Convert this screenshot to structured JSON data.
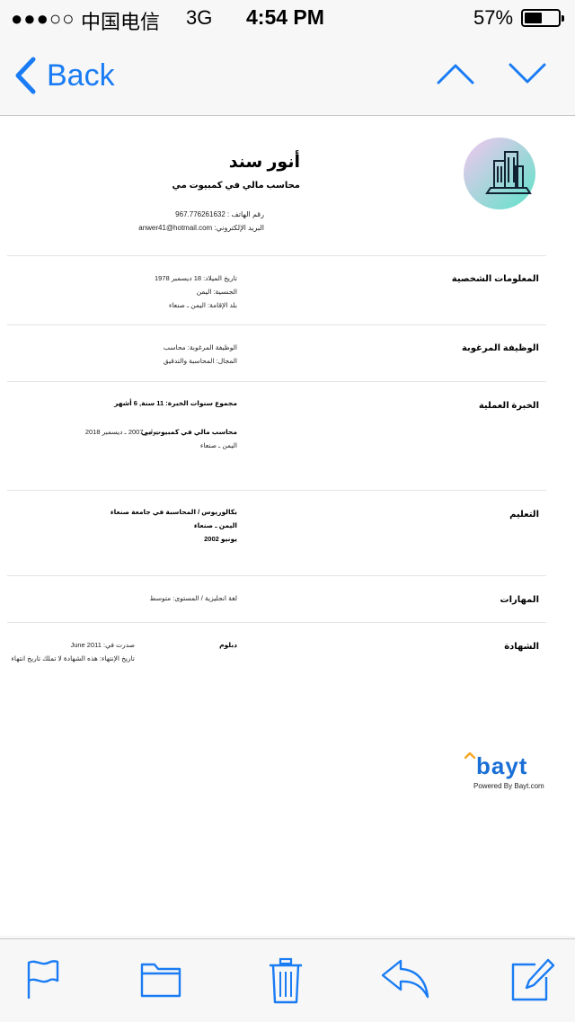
{
  "status_bar": {
    "signal": "●●●○○",
    "carrier": "中国电信",
    "network": "3G",
    "time": "4:54 PM",
    "battery": "57%",
    "battery_level": 0.57
  },
  "nav": {
    "back_label": "Back",
    "accent_color": "#1a7cf4"
  },
  "resume": {
    "name": "أنور سند",
    "subtitle": "محاسب مالي في كمبيوت مي",
    "phone": "رقم الهاتف : 967.776261632",
    "email": "البريد الإلكتروني: anwer41@hotmail.com",
    "sections": {
      "personal": {
        "heading": "المعلومات الشخصية",
        "lines": [
          "تاريخ الميلاد: 18 ديسمبر 1978",
          "الجنسية: اليمن",
          "بلد الإقامة: اليمن ـ صنعاء"
        ]
      },
      "desired_job": {
        "heading": "الوظيفة المرغوبة",
        "lines": [
          "الوظيفة المرغوبة: محاسب",
          "المجال: المحاسبة والتدقيق"
        ]
      },
      "experience": {
        "heading": "الخبرة العملية",
        "total": "مجموع سنوات الخبرة: 11 سنة, 6 أشهر",
        "job_title": "محاسب مالي في كمبيوت مي",
        "job_location": "اليمن ـ صنعاء",
        "job_dates": "يوليو 2007 ـ ديسمبر 2018"
      },
      "education": {
        "heading": "التعليم",
        "degree": "بكالوريوس / المحاسبة في جامعة صنعاء",
        "location": "اليمن ـ صنعاء",
        "date": "يونيو 2002"
      },
      "skills": {
        "heading": "المهارات",
        "line": "لغة انجليزية / المستوى: متوسط"
      },
      "certificate": {
        "heading": "الشهادة",
        "name": "دبلوم",
        "issued": "صدرت في: June 2011",
        "expiry": "تاريخ الإنتهاء: هذه الشهادة لا تملك تاريخ انتهاء"
      }
    },
    "footer": {
      "brand": "bayt",
      "powered": "Powered By Bayt.com"
    }
  },
  "toolbar": {
    "icons": [
      "flag-icon",
      "folder-icon",
      "trash-icon",
      "reply-icon",
      "compose-icon"
    ]
  }
}
